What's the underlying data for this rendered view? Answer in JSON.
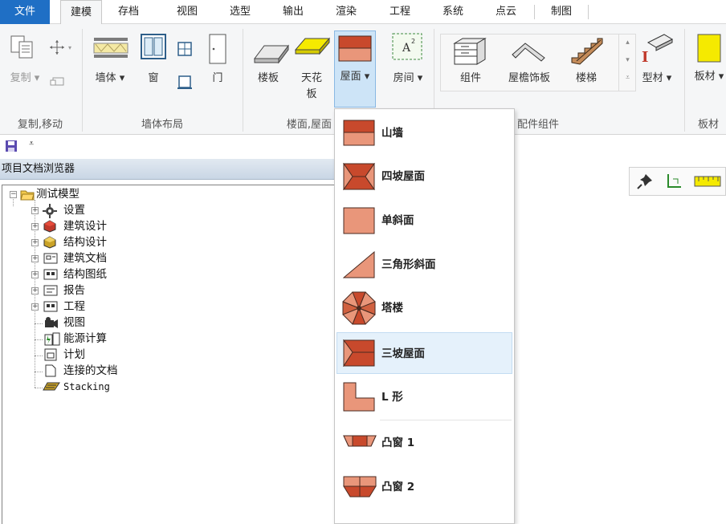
{
  "menu": {
    "tabs": [
      "文件",
      "建模",
      "存档",
      "视图",
      "选型",
      "输出",
      "渲染",
      "工程",
      "系统",
      "点云",
      "制图"
    ],
    "active": "建模"
  },
  "ribbon": {
    "copy_move": {
      "copy_label": "复制",
      "group_label": "复制,移动"
    },
    "wall_layout": {
      "wall_label": "墙体",
      "window_label": "窗",
      "door_label": "门",
      "group_label": "墙体布局"
    },
    "floor_roof": {
      "floor_label": "楼板",
      "ceiling_label": "天花板",
      "roof_label": "屋面",
      "group_label": "楼面,屋面"
    },
    "room": {
      "room_label": "房间"
    },
    "components": {
      "component_label": "组件",
      "eave_label": "屋檐饰板",
      "stairs_label": "楼梯",
      "group_label": "配件组件"
    },
    "profile": {
      "profile_label": "型材"
    },
    "board": {
      "board_label": "板材",
      "group_label": "板材"
    }
  },
  "browser": {
    "title": "项目文档浏览器",
    "root": "测试模型",
    "items": [
      "设置",
      "建筑设计",
      "结构设计",
      "建筑文档",
      "结构图纸",
      "报告",
      "工程",
      "视图",
      "能源计算",
      "计划",
      "连接的文档",
      "Stacking"
    ]
  },
  "dropdown": {
    "items": [
      "山墙",
      "四坡屋面",
      "单斜面",
      "三角形斜面",
      "塔楼",
      "三坡屋面",
      "L 形",
      "凸窗 1",
      "凸窗 2"
    ],
    "highlighted": "三坡屋面"
  },
  "colors": {
    "accent": "#1f6fc5",
    "roof_dark": "#c8492c",
    "roof_light": "#e9967a",
    "highlight": "#e5f1fb"
  }
}
